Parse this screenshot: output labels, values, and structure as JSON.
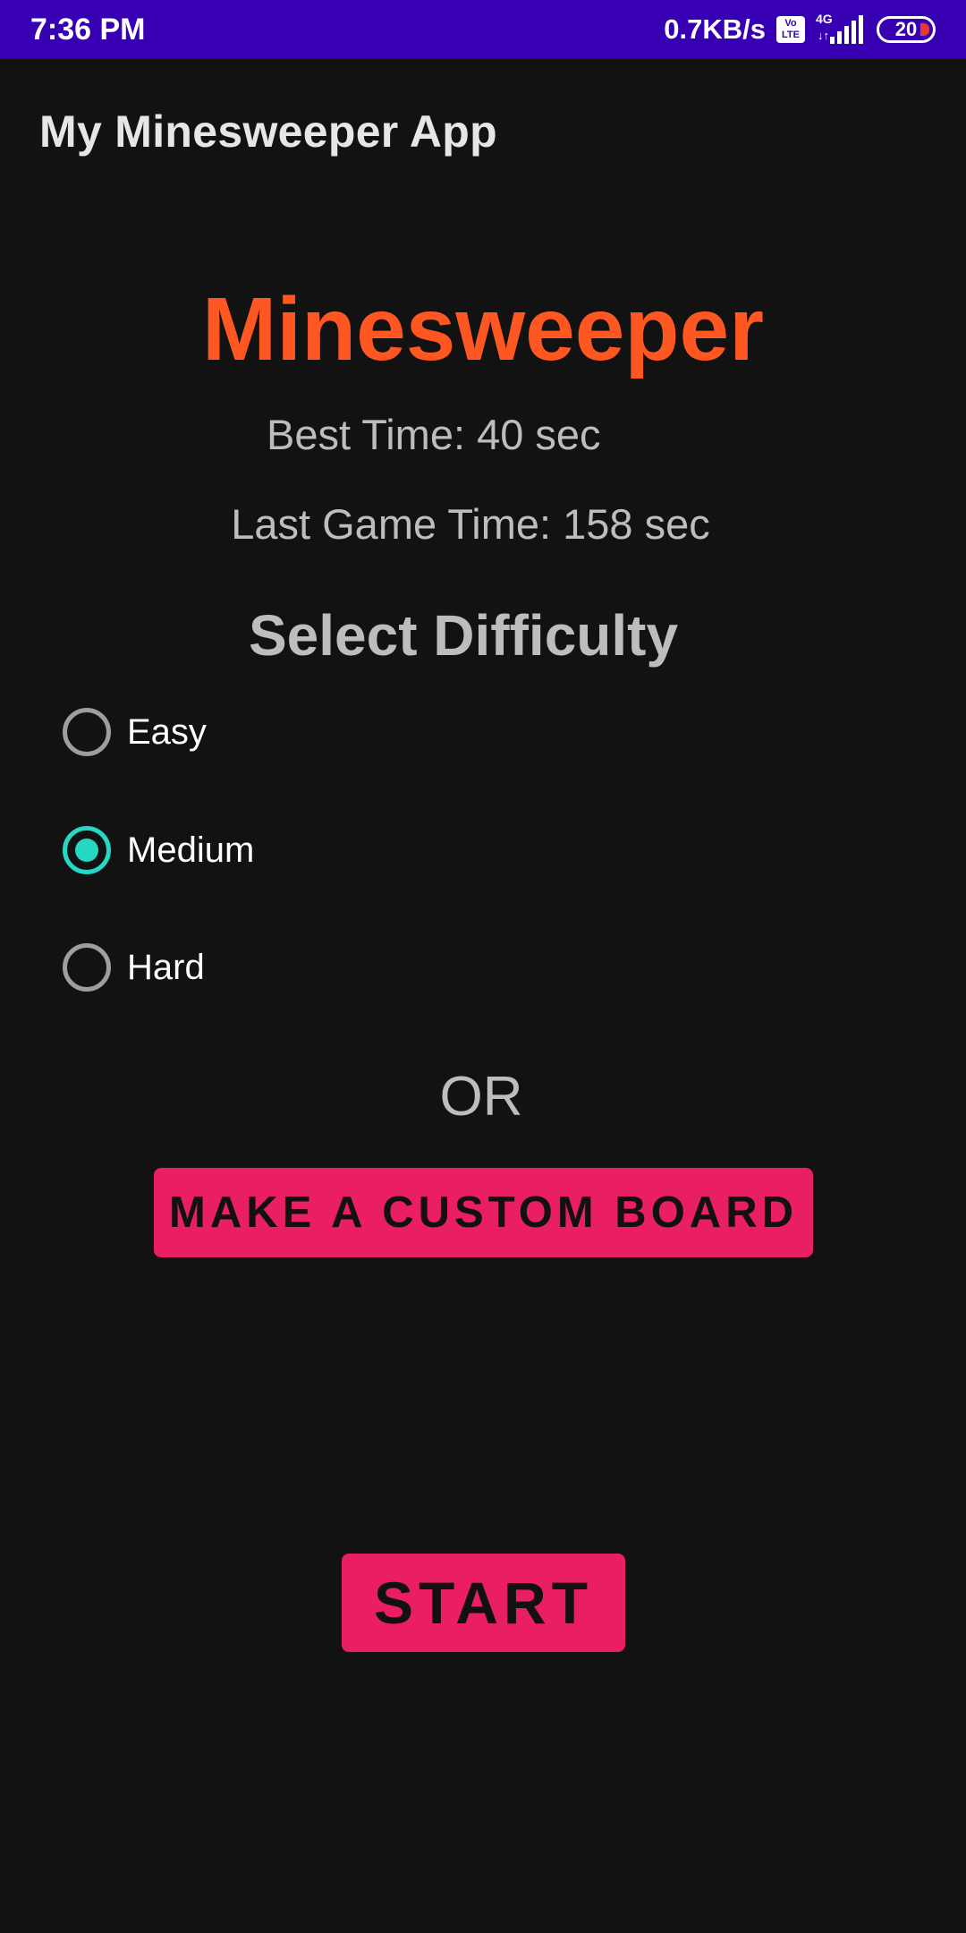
{
  "status_bar": {
    "time": "7:36 PM",
    "net_speed": "0.7KB/s",
    "volte_label": "Vo LTE",
    "network_type": "4G",
    "battery_level": "20",
    "background_color": "#3700B3"
  },
  "app_bar": {
    "title": "My Minesweeper App"
  },
  "main": {
    "game_title": "Minesweeper",
    "game_title_color": "#FF5722",
    "best_time": "Best Time: 40 sec",
    "last_game_time": "Last Game Time: 158 sec",
    "difficulty_heading": "Select Difficulty",
    "difficulty_options": [
      {
        "label": "Easy",
        "selected": false
      },
      {
        "label": "Medium",
        "selected": true
      },
      {
        "label": "Hard",
        "selected": false
      }
    ],
    "radio_accent_color": "#26d7c4",
    "or_text": "OR",
    "custom_board_button": "MAKE A CUSTOM BOARD",
    "start_button": "START",
    "button_color": "#E91E63"
  }
}
